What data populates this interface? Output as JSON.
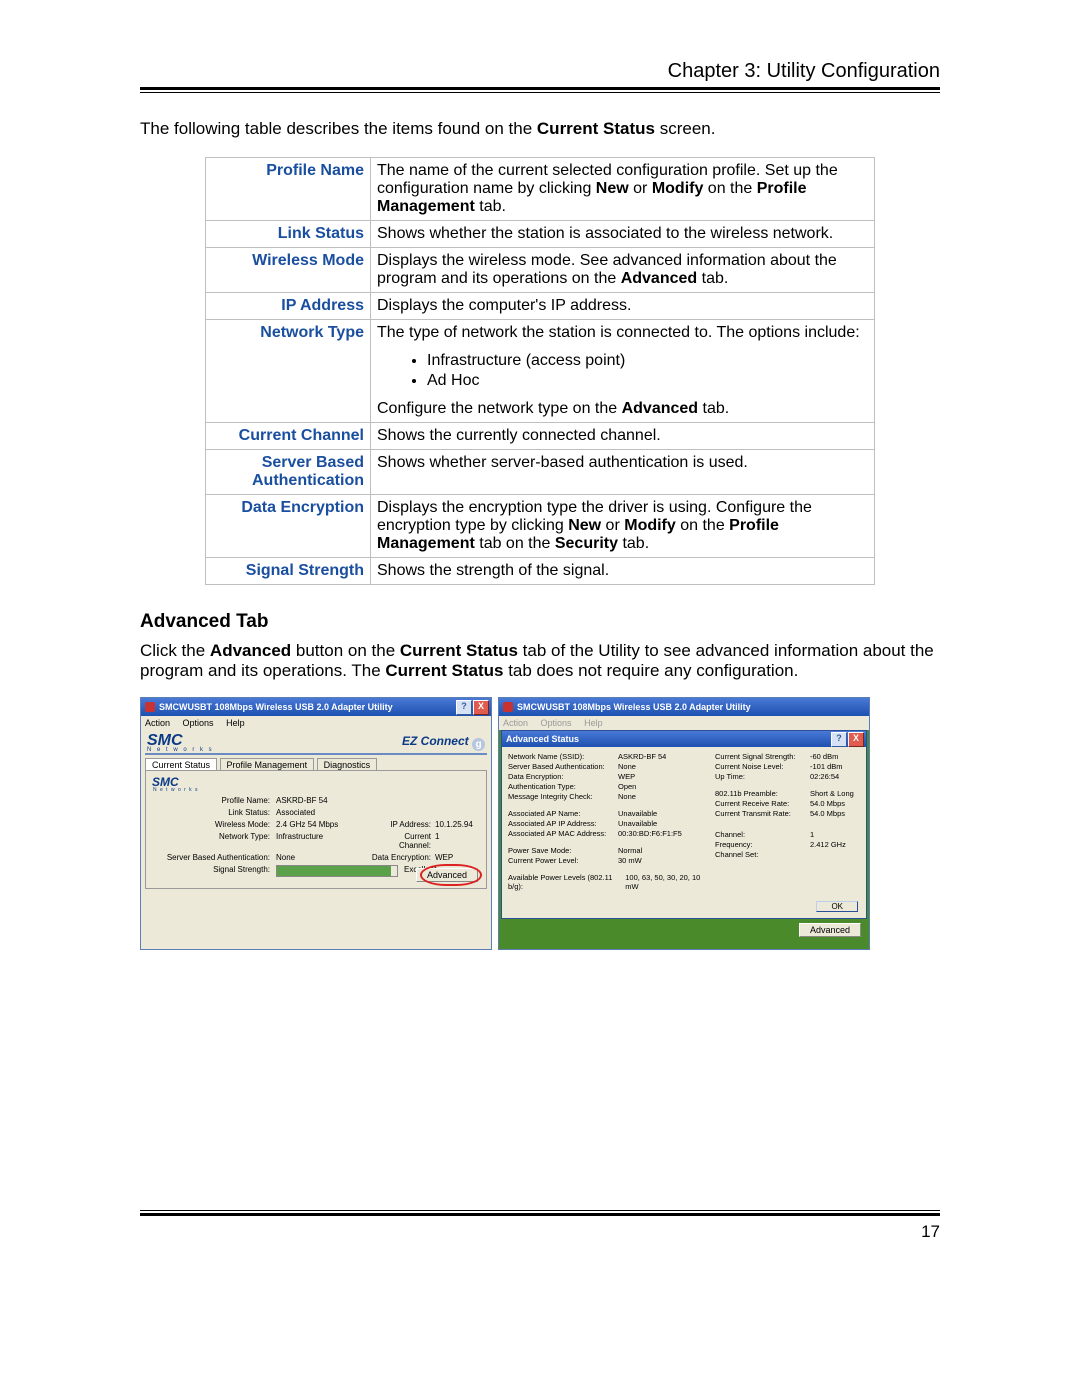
{
  "header": {
    "chapter": "Chapter 3: Utility Configuration"
  },
  "intro": {
    "pre": "The following table describes the items found on the ",
    "bold": "Current Status",
    "post": " screen."
  },
  "table": {
    "profile_name": {
      "label": "Profile Name",
      "t1": "The name of the current selected configuration profile. Set up the configuration name by clicking ",
      "b1": "New",
      "t2": " or ",
      "b2": "Modify",
      "t3": " on the ",
      "b3": "Profile Management",
      "t4": " tab."
    },
    "link_status": {
      "label": "Link Status",
      "desc": "Shows whether the station is associated to the wireless network."
    },
    "wireless_mode": {
      "label": "Wireless Mode",
      "t1": "Displays the wireless mode. See advanced information about the program and its operations on the ",
      "b1": "Advanced",
      "t2": " tab."
    },
    "ip_address": {
      "label": "IP Address",
      "desc": "Displays the computer's IP address."
    },
    "network_type": {
      "label": "Network Type",
      "intro": "The type of network the station is connected to. The options include:",
      "opts": [
        "Infrastructure (access point)",
        "Ad Hoc"
      ],
      "t1": "Configure the network type on the ",
      "b1": "Advanced",
      "t2": " tab."
    },
    "current_channel": {
      "label": "Current Channel",
      "desc": "Shows the currently connected channel."
    },
    "server_auth": {
      "label": "Server Based Authentication",
      "desc": "Shows whether server-based authentication is used."
    },
    "data_encryption": {
      "label": "Data Encryption",
      "t1": "Displays the encryption type the driver is using. Configure the encryption type by clicking ",
      "b1": "New",
      "t2": " or ",
      "b2": "Modify",
      "t3": " on the ",
      "b3": "Profile Management",
      "t4": " tab on the ",
      "b4": "Security",
      "t5": " tab."
    },
    "signal_strength": {
      "label": "Signal Strength",
      "desc": "Shows the strength of the signal."
    }
  },
  "advanced_section": {
    "heading": "Advanced Tab",
    "p": {
      "t1": "Click the ",
      "b1": "Advanced",
      "t2": " button on the ",
      "b2": "Current Status",
      "t3": " tab of the Utility to see advanced information about the program and its operations. The ",
      "b3": "Current Status",
      "t4": " tab does not require any configuration."
    }
  },
  "left_window": {
    "title": "SMCWUSBT 108Mbps Wireless USB 2.0 Adapter Utility",
    "help_btn": "?",
    "close_btn": "X",
    "menu": {
      "action": "Action",
      "options": "Options",
      "help": "Help"
    },
    "logo": "SMC",
    "logo_sub": "N e t w o r k s",
    "ez": "EZ Connect",
    "ez_g": "g",
    "tabs": {
      "current": "Current Status",
      "profile": "Profile Management",
      "diag": "Diagnostics"
    },
    "rows": {
      "profile_l": "Profile Name:",
      "profile_v": "ASKRD-BF 54",
      "link_l": "Link Status:",
      "link_v": "Associated",
      "wmode_l": "Wireless Mode:",
      "wmode_v": "2.4 GHz 54 Mbps",
      "ip_l": "IP Address:",
      "ip_v": "10.1.25.94",
      "ntype_l": "Network Type:",
      "ntype_v": "Infrastructure",
      "cchan_l": "Current Channel:",
      "cchan_v": "1",
      "sauth_l": "Server Based Authentication:",
      "sauth_v": "None",
      "denc_l": "Data Encryption:",
      "denc_v": "WEP",
      "sig_l": "Signal Strength:",
      "sig_v": "Excellent"
    },
    "adv_btn": "Advanced"
  },
  "right_window": {
    "title": "SMCWUSBT 108Mbps Wireless USB 2.0 Adapter Utility",
    "help_btn": "?",
    "close_btn": "X",
    "menu": {
      "action": "Action",
      "options": "Options",
      "help": "Help"
    },
    "sub_title": "Advanced Status",
    "col1": {
      "ssid_l": "Network Name (SSID):",
      "ssid_v": "ASKRD-BF 54",
      "sba_l": "Server Based Authentication:",
      "sba_v": "None",
      "de_l": "Data Encryption:",
      "de_v": "WEP",
      "at_l": "Authentication Type:",
      "at_v": "Open",
      "mic_l": "Message Integrity Check:",
      "mic_v": "None",
      "apn_l": "Associated AP Name:",
      "apn_v": "Unavailable",
      "apip_l": "Associated AP IP Address:",
      "apip_v": "Unavailable",
      "apmac_l": "Associated AP MAC Address:",
      "apmac_v": "00:30:BD:F6:F1:F5",
      "psm_l": "Power Save Mode:",
      "psm_v": "Normal",
      "cpl_l": "Current Power Level:",
      "cpl_v": "30 mW",
      "apl_l": "Available Power Levels (802.11 b/g):",
      "apl_v": "100, 63, 50, 30, 20, 10 mW"
    },
    "col2": {
      "css_l": "Current Signal Strength:",
      "css_v": "-60 dBm",
      "cnl_l": "Current Noise Level:",
      "cnl_v": "-101 dBm",
      "ut_l": "Up Time:",
      "ut_v": "02:26:54",
      "pre_l": "802.11b Preamble:",
      "pre_v": "Short & Long",
      "crr_l": "Current Receive Rate:",
      "crr_v": "54.0 Mbps",
      "ctr_l": "Current Transmit Rate:",
      "ctr_v": "54.0 Mbps",
      "ch_l": "Channel:",
      "ch_v": "1",
      "fr_l": "Frequency:",
      "fr_v": "2.412 GHz",
      "cs_l": "Channel Set:",
      "cs_v": ""
    },
    "ok_btn": "OK",
    "adv_btn": "Advanced"
  },
  "page_number": "17"
}
